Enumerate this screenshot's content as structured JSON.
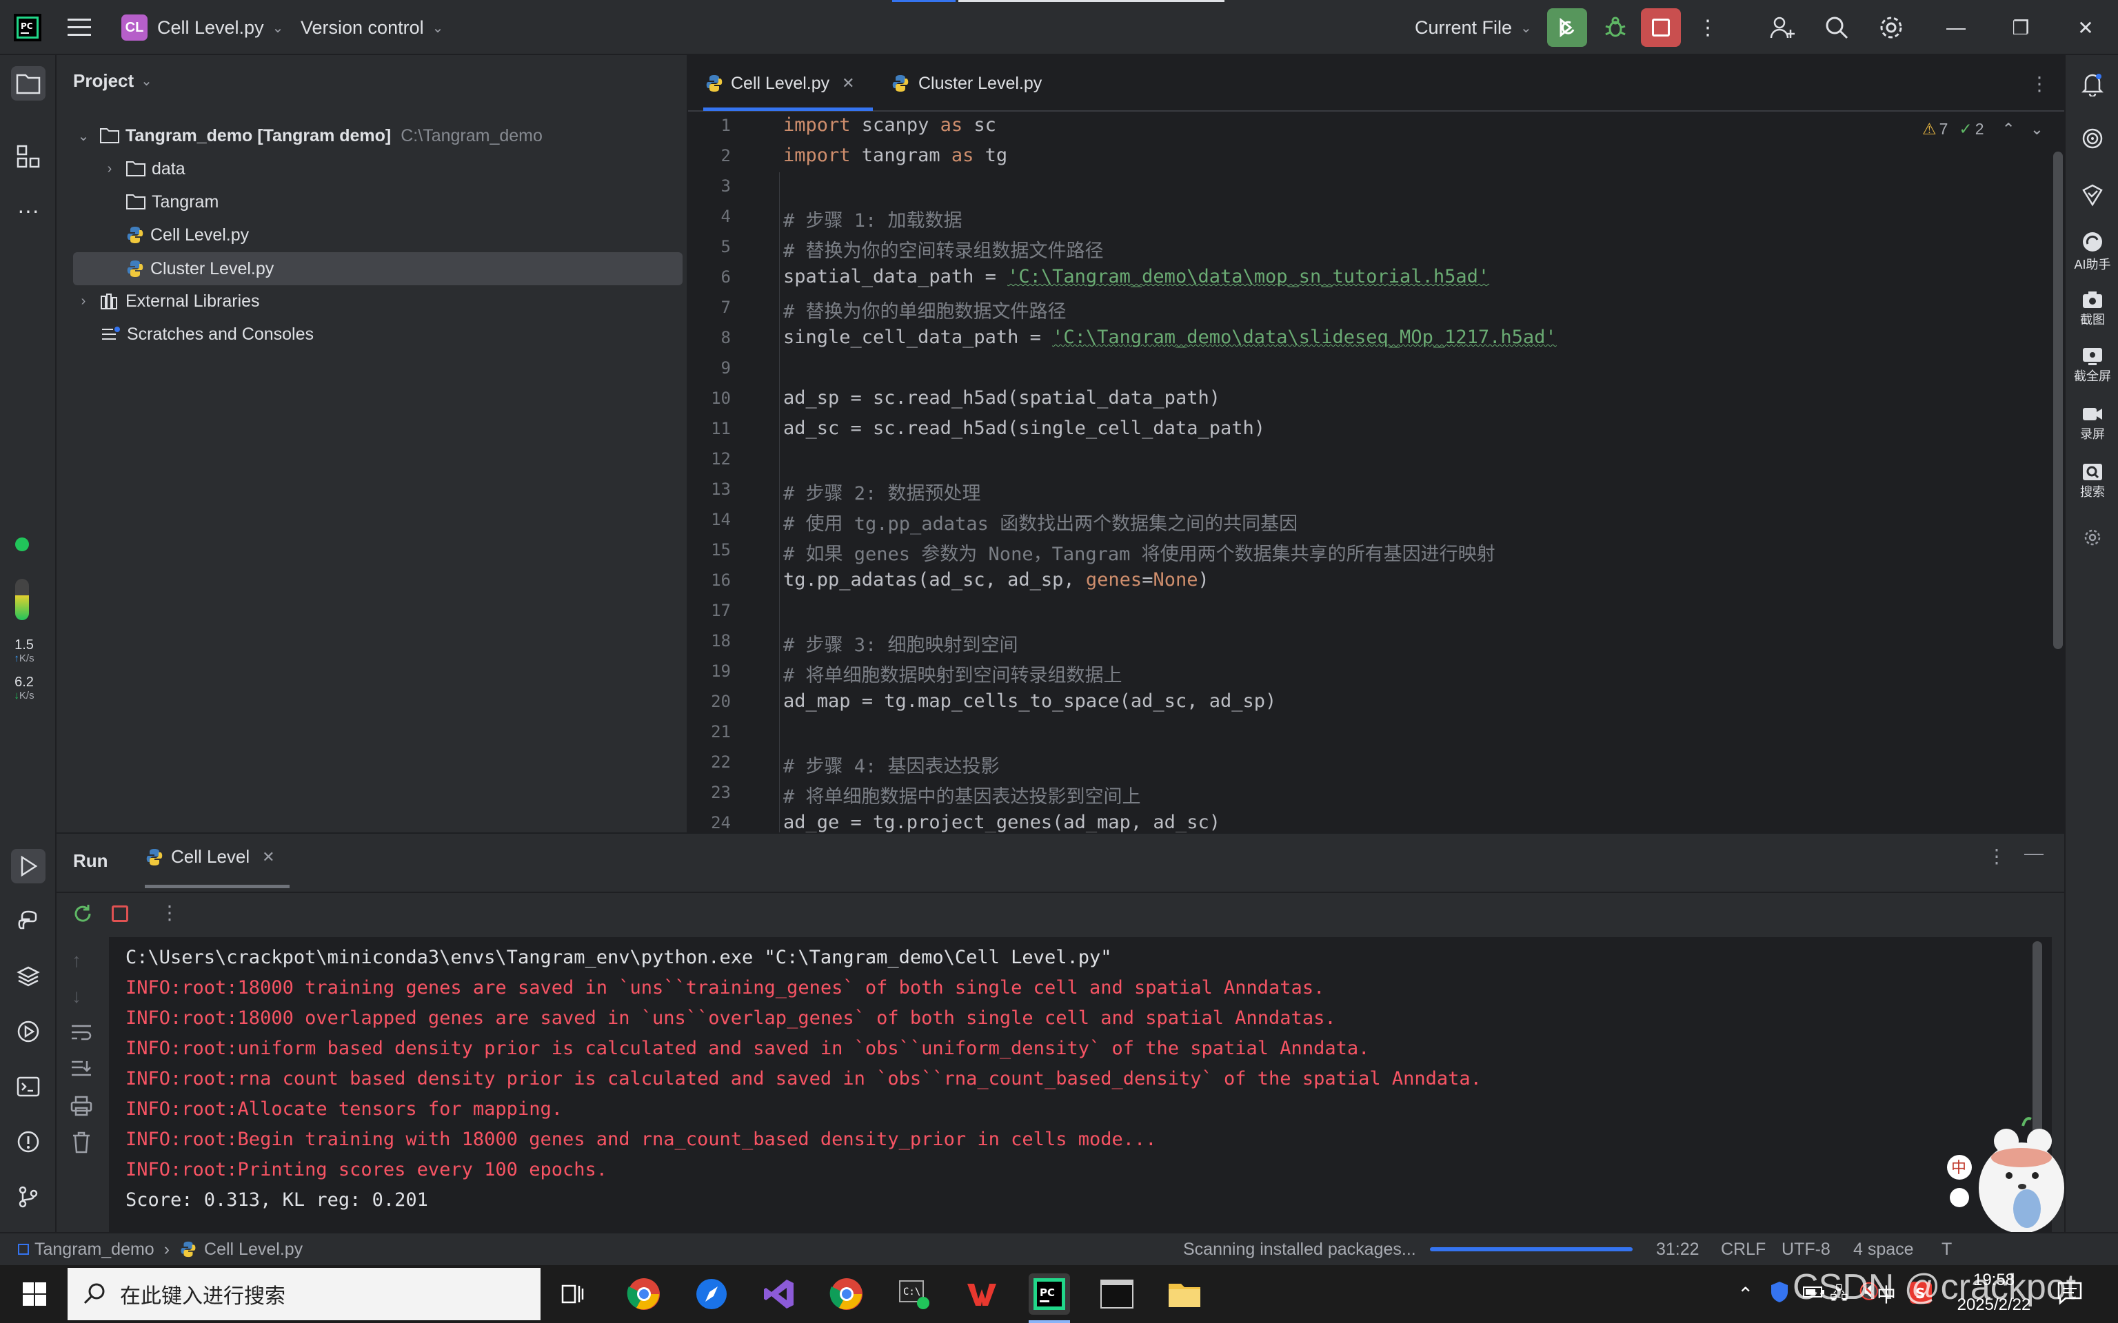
{
  "titlebar": {
    "project_badge": "CL",
    "project_name": "Cell Level.py",
    "version_control": "Version control",
    "run_config": "Current File",
    "accent_run": "#57965c",
    "accent_stop": "#c94f4f"
  },
  "project_panel": {
    "title": "Project",
    "root_name": "Tangram_demo [Tangram   demo]",
    "root_path": "C:\\Tangram_demo",
    "items": [
      {
        "label": "data",
        "type": "folder"
      },
      {
        "label": "Tangram",
        "type": "folder"
      },
      {
        "label": "Cell Level.py",
        "type": "python"
      },
      {
        "label": "Cluster Level.py",
        "type": "python"
      }
    ],
    "external_libraries": "External Libraries",
    "scratches": "Scratches and Consoles"
  },
  "left_strip": {
    "net_up_value": "1.5",
    "net_up_unit": "K/s",
    "net_down_value": "6.2",
    "net_down_unit": "K/s"
  },
  "editor": {
    "tabs": [
      {
        "label": "Cell Level.py",
        "active": true
      },
      {
        "label": "Cluster Level.py",
        "active": false
      }
    ],
    "warnings": "7",
    "weak_warnings": "2",
    "line_numbers": [
      "1",
      "2",
      "3",
      "4",
      "5",
      "6",
      "7",
      "8",
      "9",
      "10",
      "11",
      "12",
      "13",
      "14",
      "15",
      "16",
      "17",
      "18",
      "19",
      "20",
      "21",
      "22",
      "23",
      "24"
    ],
    "code": {
      "l1_kw1": "import",
      "l1_mod": " scanpy ",
      "l1_kw2": "as",
      "l1_alias": " sc",
      "l2_kw1": "import",
      "l2_mod": " tangram ",
      "l2_kw2": "as",
      "l2_alias": " tg",
      "l4": "# 步骤 1: 加载数据",
      "l5": "# 替换为你的空间转录组数据文件路径",
      "l6_var": "spatial_data_path = ",
      "l6_str": "'C:\\Tangram_demo\\data\\mop_sn_tutorial.h5ad'",
      "l7": "# 替换为你的单细胞数据文件路径",
      "l8_var": "single_cell_data_path = ",
      "l8_str": "'C:\\Tangram_demo\\data\\slideseq_MOp_1217.h5ad'",
      "l10": "ad_sp = sc.read_h5ad(spatial_data_path)",
      "l11": "ad_sc = sc.read_h5ad(single_cell_data_path)",
      "l13": "# 步骤 2: 数据预处理",
      "l14": "# 使用 tg.pp_adatas 函数找出两个数据集之间的共同基因",
      "l15": "# 如果 genes 参数为 None，Tangram 将使用两个数据集共享的所有基因进行映射",
      "l16_a": "tg.pp_adatas(ad_sc, ad_sp, ",
      "l16_kw": "genes",
      "l16_eq": "=",
      "l16_none": "None",
      "l16_b": ")",
      "l18": "# 步骤 3: 细胞映射到空间",
      "l19": "# 将单细胞数据映射到空间转录组数据上",
      "l20": "ad_map = tg.map_cells_to_space(ad_sc, ad_sp)",
      "l22": "# 步骤 4: 基因表达投影",
      "l23": "# 将单细胞数据中的基因表达投影到空间上",
      "l24": "ad_ge = tg.project_genes(ad_map, ad_sc)"
    }
  },
  "right_strip": {
    "ai_label": "AI助手",
    "screenshot_label": "截图",
    "fullscreen_label": "截全屏",
    "record_label": "录屏",
    "search_label": "搜索"
  },
  "run_panel": {
    "title": "Run",
    "tab_label": "Cell Level",
    "console": [
      {
        "text": "C:\\Users\\crackpot\\miniconda3\\envs\\Tangram_env\\python.exe \"C:\\Tangram_demo\\Cell Level.py\"",
        "kind": "plain"
      },
      {
        "text": "INFO:root:18000 training genes are saved in `uns``training_genes` of both single cell and spatial Anndatas.",
        "kind": "info"
      },
      {
        "text": "INFO:root:18000 overlapped genes are saved in `uns``overlap_genes` of both single cell and spatial Anndatas.",
        "kind": "info"
      },
      {
        "text": "INFO:root:uniform based density prior is calculated and saved in `obs``uniform_density` of the spatial Anndata.",
        "kind": "info"
      },
      {
        "text": "INFO:root:rna count based density prior is calculated and saved in `obs``rna_count_based_density` of the spatial Anndata.",
        "kind": "info"
      },
      {
        "text": "INFO:root:Allocate tensors for mapping.",
        "kind": "info"
      },
      {
        "text": "INFO:root:Begin training with 18000 genes and rna_count_based density_prior in cells mode...",
        "kind": "info"
      },
      {
        "text": "INFO:root:Printing scores every 100 epochs.",
        "kind": "info"
      },
      {
        "text": "Score: 0.313, KL reg: 0.201",
        "kind": "plain"
      }
    ]
  },
  "statusbar": {
    "project": "Tangram_demo",
    "file": "Cell Level.py",
    "progress_text": "Scanning installed packages...",
    "progress_fraction": 1.0,
    "position": "31:22",
    "line_ending": "CRLF",
    "encoding": "UTF-8",
    "indent": "4 space",
    "indent_suffix": "T"
  },
  "taskbar": {
    "search_placeholder": "在此键入进行搜索",
    "ime": "中",
    "time": "19:58",
    "date": "2025/2/22",
    "watermark": "CSDN @crackpot"
  }
}
